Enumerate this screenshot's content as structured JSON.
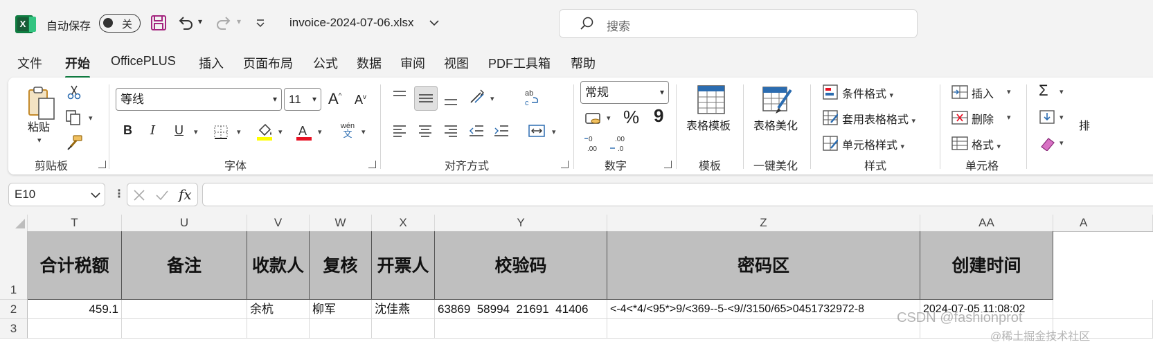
{
  "titlebar": {
    "app_icon_letter": "X",
    "autosave_label": "自动保存",
    "autosave_state": "关",
    "filename": "invoice-2024-07-06.xlsx",
    "search_placeholder": "搜索"
  },
  "tabs": [
    "文件",
    "开始",
    "OfficePLUS",
    "插入",
    "页面布局",
    "公式",
    "数据",
    "审阅",
    "视图",
    "PDF工具箱",
    "帮助"
  ],
  "active_tab": "开始",
  "ribbon": {
    "clipboard": {
      "paste": "粘贴",
      "label": "剪贴板"
    },
    "font": {
      "name": "等线",
      "size": "11",
      "grow": "A",
      "shrink": "A",
      "bold": "B",
      "italic": "I",
      "underline": "U",
      "phonetic_top": "wén",
      "phonetic_bottom": "文",
      "label": "字体",
      "highlight_color": "#ffff00",
      "font_color": "#e81123"
    },
    "alignment": {
      "label": "对齐方式"
    },
    "number": {
      "format": "常规",
      "percent": "%",
      "comma": "9",
      "inc_decimal": "←0 .00",
      "dec_decimal": ".00 →0",
      "label": "数字"
    },
    "templates": {
      "button": "表格模板",
      "label": "模板"
    },
    "beautify": {
      "button": "表格美化",
      "label": "一键美化"
    },
    "styles": {
      "conditional": "条件格式",
      "table": "套用表格格式",
      "cell": "单元格样式",
      "label": "样式"
    },
    "cells": {
      "insert": "插入",
      "delete": "删除",
      "format": "格式",
      "label": "单元格"
    },
    "editing": {
      "sum": "Σ",
      "partial_label": "排"
    }
  },
  "formula_bar": {
    "name_box": "E10",
    "fx": "fx",
    "formula": ""
  },
  "sheet": {
    "columns": [
      "T",
      "U",
      "V",
      "W",
      "X",
      "Y",
      "Z",
      "AA",
      "A"
    ],
    "rows": [
      "1",
      "2",
      "3"
    ],
    "headers": [
      "合计税额",
      "备注",
      "收款人",
      "复核",
      "开票人",
      "校验码",
      "密码区",
      "创建时间"
    ],
    "row2": [
      "459.1",
      "",
      "余杭",
      "柳军",
      "沈佳燕",
      "63869  58994  21691  41406",
      "<-4<*4/<95*>9/<369--5-<9//3150/65>0451732972-8",
      "2024-07-05 11:08:02"
    ]
  },
  "watermarks": {
    "csdn": "CSDN @fashionprot",
    "juejin": "@稀土掘金技术社区"
  }
}
